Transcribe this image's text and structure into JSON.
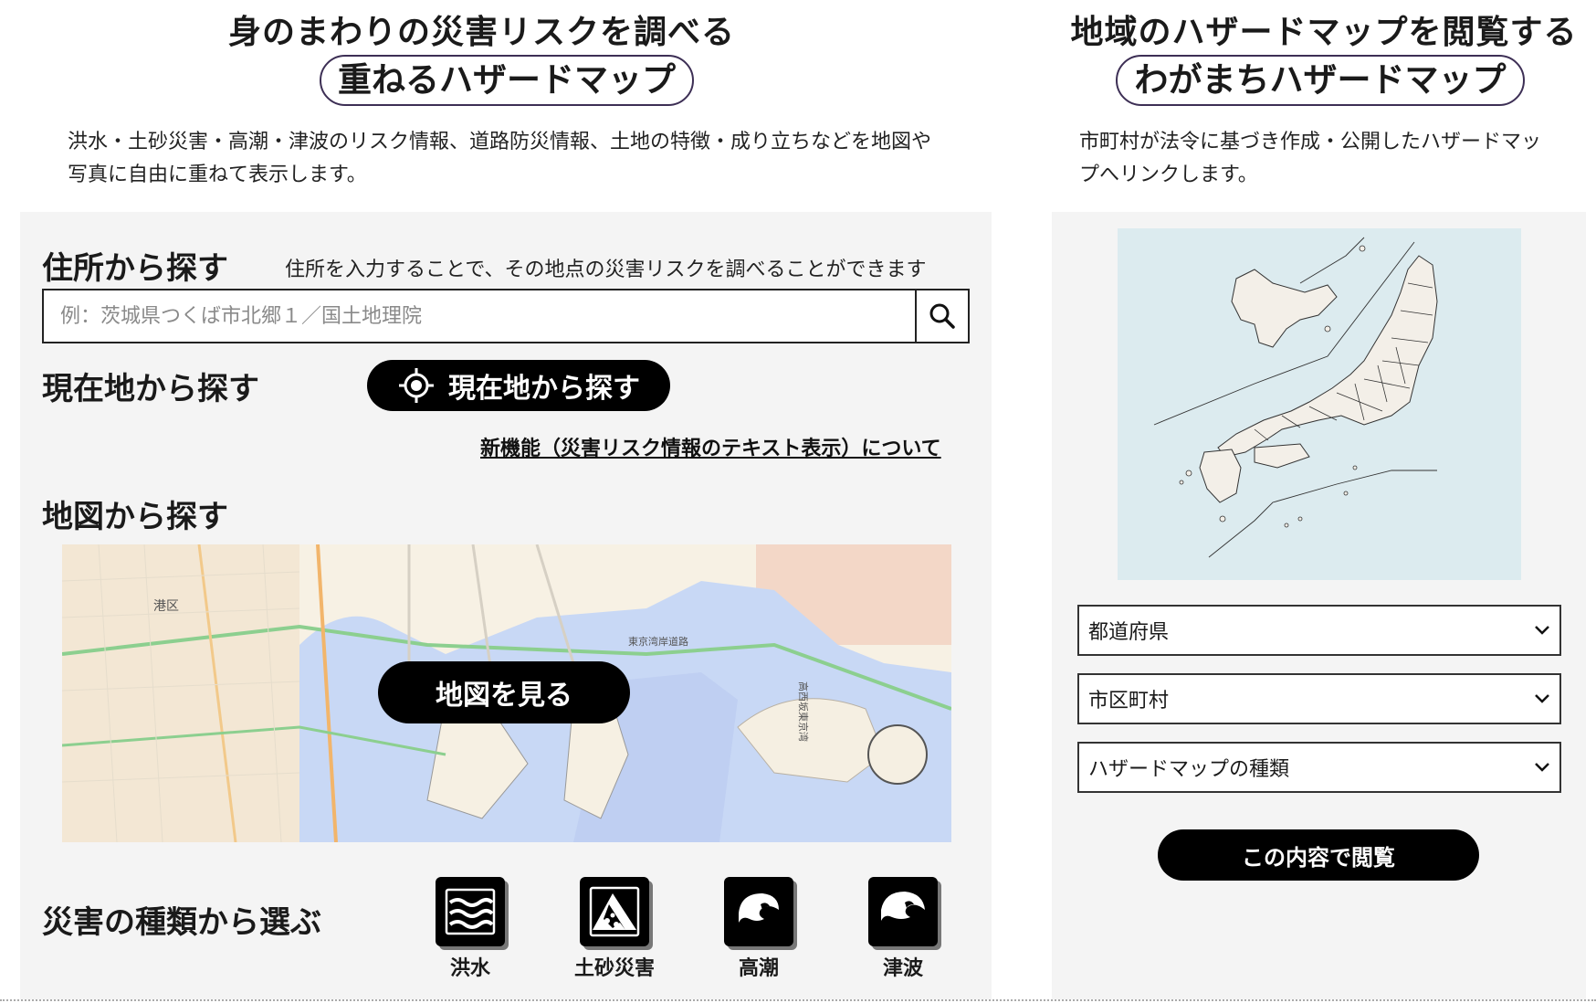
{
  "left": {
    "headline": "身のまわりの災害リスクを調べる",
    "title": "重ねるハザードマップ",
    "description": "洪水・土砂災害・高潮・津波のリスク情報、道路防災情報、土地の特徴・成り立ちなどを地図や写真に自由に重ねて表示します。",
    "address_search": {
      "title": "住所から探す",
      "hint": "住所を入力することで、その地点の災害リスクを調べることができます",
      "placeholder": "例：茨城県つくば市北郷１／国土地理院"
    },
    "current_location": {
      "title": "現在地から探す",
      "button_label": "現在地から探す"
    },
    "new_feature_link": "新機能（災害リスク情報のテキスト表示）について",
    "map_search": {
      "title": "地図から探す",
      "button_label": "地図を見る",
      "map_labels": [
        "港区",
        "東京湾岸道路",
        "高西坂東京湾"
      ]
    },
    "disaster_type": {
      "title": "災害の種類から選ぶ",
      "items": [
        {
          "label": "洪水",
          "icon": "flood-icon"
        },
        {
          "label": "土砂災害",
          "icon": "landslide-icon"
        },
        {
          "label": "高潮",
          "icon": "storm-surge-icon"
        },
        {
          "label": "津波",
          "icon": "tsunami-icon"
        }
      ]
    }
  },
  "right": {
    "headline": "地域のハザードマップを閲覧する",
    "title": "わがまちハザードマップ",
    "description": "市町村が法令に基づき作成・公開したハザードマップへリンクします。",
    "selects": [
      {
        "value": "都道府県"
      },
      {
        "value": "市区町村"
      },
      {
        "value": "ハザードマップの種類"
      }
    ],
    "submit_label": "この内容で閲覧"
  },
  "colors": {
    "panel_bg": "#f4f4f4",
    "button_bg": "#000000",
    "title_border": "#3d2f55",
    "sea": "#c8d8f5",
    "japan_sea": "#dcebef",
    "japan_land": "#f3efe8"
  }
}
